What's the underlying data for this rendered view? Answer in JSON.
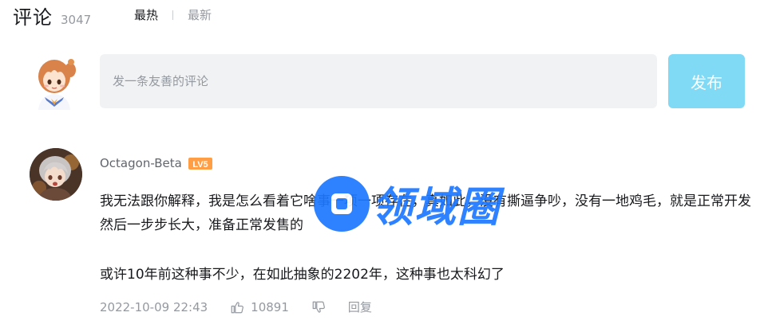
{
  "header": {
    "title": "评论",
    "count": "3047",
    "sort_hot": "最热",
    "sort_new": "最新"
  },
  "reply_box": {
    "placeholder": "发一条友善的评论",
    "publish_label": "发布"
  },
  "comment": {
    "username": "Octagon-Beta",
    "level_badge": "LV5",
    "paragraph_1": "我无法跟你解释，我是怎么看着它啥事一项一项存在，真如此，没有撕逼争吵，没有一地鸡毛，就是正常开发然后一步步长大，准备正常发售的",
    "paragraph_2": "或许10年前这种事不少，在如此抽象的2202年，这种事也太科幻了",
    "time": "2022-10-09 22:43",
    "likes": "10891",
    "reply_label": "回复"
  },
  "watermark": {
    "text": "领域圈"
  },
  "colors": {
    "accent": "#80daf6",
    "watermark_blue": "#1e78ff",
    "muted": "#9499a0",
    "level_orange": "#ff9e45"
  }
}
